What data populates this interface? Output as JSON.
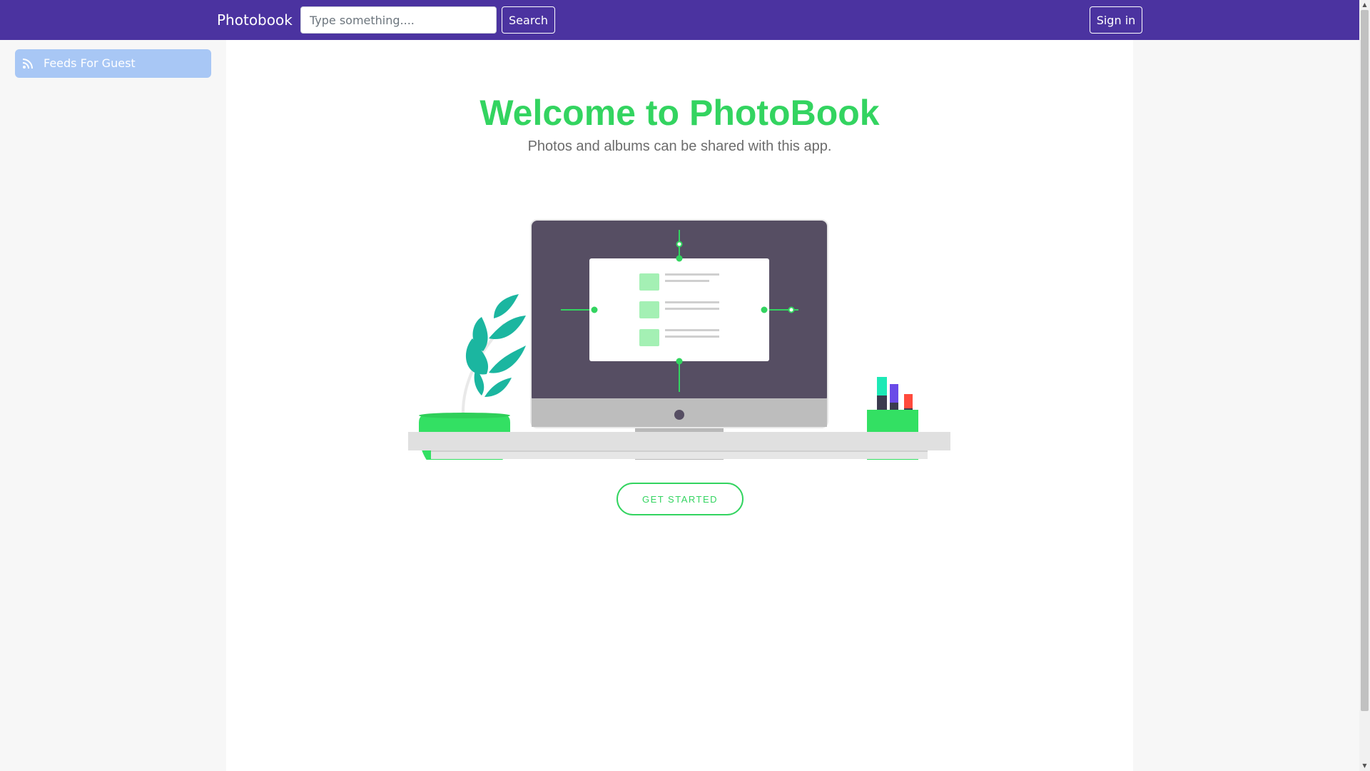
{
  "navbar": {
    "brand": "Photobook",
    "search": {
      "placeholder": "Type something....",
      "value": "",
      "button_label": "Search"
    },
    "signin_label": "Sign in",
    "background": "#4b33a0"
  },
  "sidebar": {
    "items": [
      {
        "label": "Feeds For Guest",
        "icon": "rss-icon"
      }
    ],
    "item_background": "#a8c7f5"
  },
  "main": {
    "title": "Welcome to PhotoBook",
    "subtitle": "Photos and albums can be shared with this app.",
    "cta_label": "GET STARTED",
    "accent": "#33d460"
  }
}
